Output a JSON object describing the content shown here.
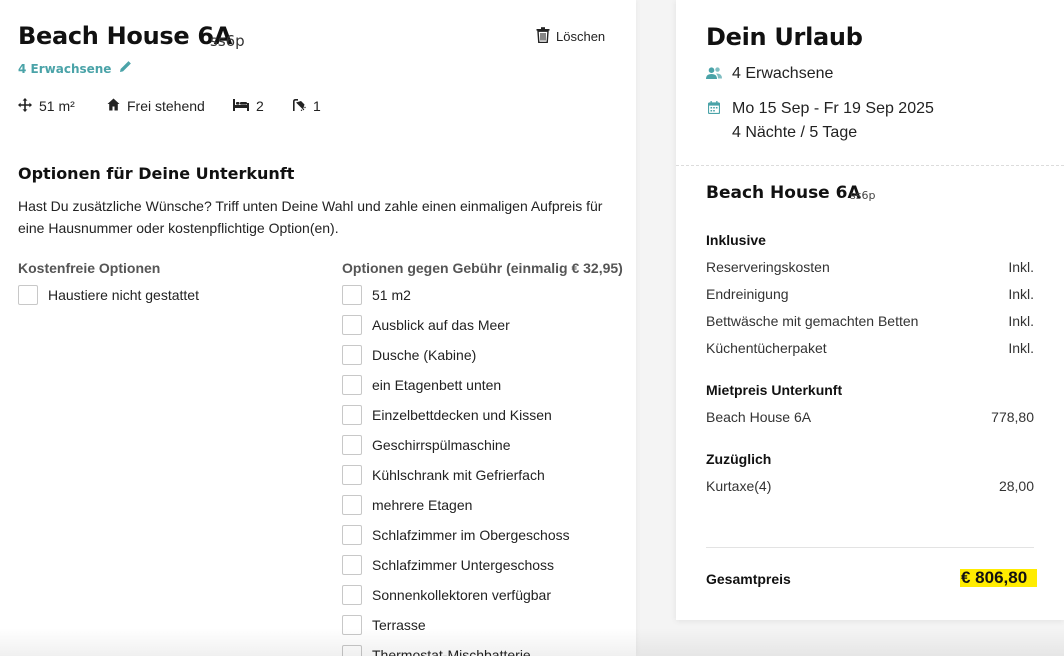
{
  "accent_color": "#4aa3a8",
  "highlight_color": "#ffec00",
  "left": {
    "house_name": "Beach House 6A",
    "house_code": "ss6p",
    "delete_label": "Löschen",
    "guests_label": "4 Erwachsene",
    "facts": {
      "area": "51 m²",
      "type": "Frei stehend",
      "beds": "2",
      "baths": "1"
    },
    "options_heading": "Optionen für Deine Unterkunft",
    "options_description": "Hast Du zusätzliche Wünsche? Triff unten Deine Wahl und zahle einen einmaligen Aufpreis für eine Hausnummer oder kostenpflichtige Option(en).",
    "free_heading": "Kostenfreie Optionen",
    "free_options": [
      "Haustiere nicht gestattet"
    ],
    "paid_heading": "Optionen gegen Gebühr (einmalig € 32,95)",
    "paid_options": [
      "51 m2",
      "Ausblick auf das Meer",
      "Dusche (Kabine)",
      "ein Etagenbett unten",
      "Einzelbettdecken und Kissen",
      "Geschirrspülmaschine",
      "Kühlschrank mit Gefrierfach",
      "mehrere Etagen",
      "Schlafzimmer im Obergeschoss",
      "Schlafzimmer Untergeschoss",
      "Sonnenkollektoren verfügbar",
      "Terrasse",
      "Thermostat-Mischbatterie"
    ]
  },
  "summary": {
    "title": "Dein Urlaub",
    "guests": "4 Erwachsene",
    "dates": "Mo 15 Sep - Fr 19 Sep 2025",
    "duration": "4 Nächte / 5 Tage",
    "house_name": "Beach House 6A",
    "house_code": "ss6p",
    "inclusive_heading": "Inklusive",
    "inclusive_items": [
      {
        "label": "Reserveringskosten",
        "value": "Inkl."
      },
      {
        "label": "Endreinigung",
        "value": "Inkl."
      },
      {
        "label": "Bettwäsche mit gemachten Betten",
        "value": "Inkl."
      },
      {
        "label": "Küchentücherpaket",
        "value": "Inkl."
      }
    ],
    "rent_heading": "Mietpreis Unterkunft",
    "rent_items": [
      {
        "label": "Beach House 6A",
        "value": "778,80"
      }
    ],
    "extra_heading": "Zuzüglich",
    "extra_items": [
      {
        "label": "Kurtaxe(4)",
        "value": "28,00"
      }
    ],
    "total_label": "Gesamtpreis",
    "total_value": "€ 806,80"
  }
}
